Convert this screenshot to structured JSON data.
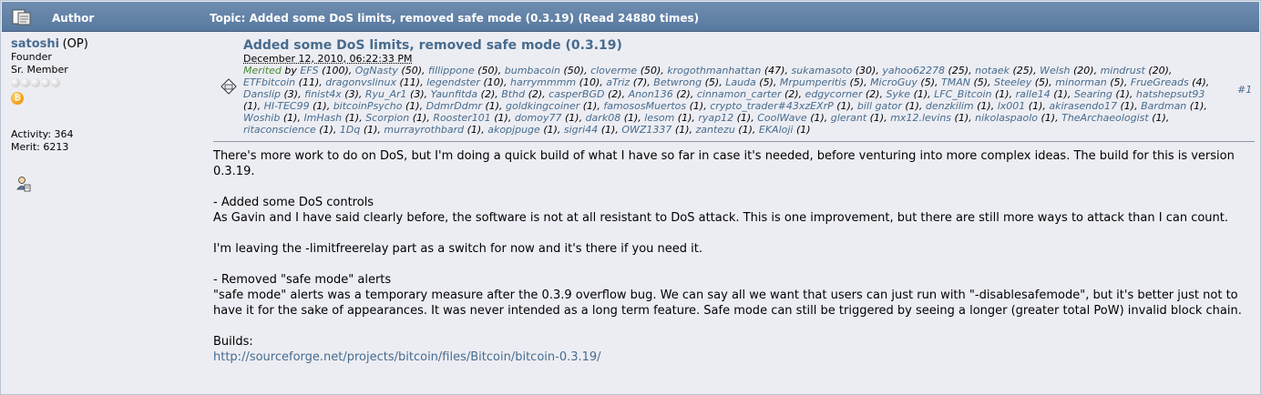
{
  "header": {
    "author_label": "Author",
    "topic_label": "Topic: Added some DoS limits, removed safe mode (0.3.19)  (Read 24880 times)"
  },
  "poster": {
    "name": "satoshi",
    "op_tag": "(OP)",
    "title": "Founder",
    "rank": "Sr. Member",
    "stars": 5,
    "activity": "Activity: 364",
    "merit": "Merit: 6213"
  },
  "post": {
    "subject": "Added some DoS limits, removed safe mode (0.3.19)",
    "date": "December 12, 2010, 06:22:33 PM",
    "merited_label": "Merited",
    "merited_by": "by",
    "merits": [
      [
        "EFS",
        "(100)"
      ],
      [
        "OgNasty",
        "(50)"
      ],
      [
        "fillippone",
        "(50)"
      ],
      [
        "bumbacoin",
        "(50)"
      ],
      [
        "cloverme",
        "(50)"
      ],
      [
        "krogothmanhattan",
        "(47)"
      ],
      [
        "sukamasoto",
        "(30)"
      ],
      [
        "yahoo62278",
        "(25)"
      ],
      [
        "notaek",
        "(25)"
      ],
      [
        "Welsh",
        "(20)"
      ],
      [
        "mindrust",
        "(20)"
      ],
      [
        "ETFbitcoin",
        "(11)"
      ],
      [
        "dragonvslinux",
        "(11)"
      ],
      [
        "legendster",
        "(10)"
      ],
      [
        "harrymmmm",
        "(10)"
      ],
      [
        "aTriz",
        "(7)"
      ],
      [
        "Betwrong",
        "(5)"
      ],
      [
        "Lauda",
        "(5)"
      ],
      [
        "Mrpumperitis",
        "(5)"
      ],
      [
        "MicroGuy",
        "(5)"
      ],
      [
        "TMAN",
        "(5)"
      ],
      [
        "Steeley",
        "(5)"
      ],
      [
        "minorman",
        "(5)"
      ],
      [
        "FrueGreads",
        "(4)"
      ],
      [
        "Danslip",
        "(3)"
      ],
      [
        "finist4x",
        "(3)"
      ],
      [
        "Ryu_Ar1",
        "(3)"
      ],
      [
        "Yaunfitda",
        "(2)"
      ],
      [
        "Bthd",
        "(2)"
      ],
      [
        "casperBGD",
        "(2)"
      ],
      [
        "Anon136",
        "(2)"
      ],
      [
        "cinnamon_carter",
        "(2)"
      ],
      [
        "edgycorner",
        "(2)"
      ],
      [
        "Syke",
        "(1)"
      ],
      [
        "LFC_Bitcoin",
        "(1)"
      ],
      [
        "ralle14",
        "(1)"
      ],
      [
        "Searing",
        "(1)"
      ],
      [
        "hatshepsut93",
        "(1)"
      ],
      [
        "HI-TEC99",
        "(1)"
      ],
      [
        "bitcoinPsycho",
        "(1)"
      ],
      [
        "DdmrDdmr",
        "(1)"
      ],
      [
        "goldkingcoiner",
        "(1)"
      ],
      [
        "famososMuertos",
        "(1)"
      ],
      [
        "crypto_trader#43xzEXrP",
        "(1)"
      ],
      [
        "bill gator",
        "(1)"
      ],
      [
        "denzkilim",
        "(1)"
      ],
      [
        "lx001",
        "(1)"
      ],
      [
        "akirasendo17",
        "(1)"
      ],
      [
        "Bardman",
        "(1)"
      ],
      [
        "Woshib",
        "(1)"
      ],
      [
        "ImHash",
        "(1)"
      ],
      [
        "Scorpion",
        "(1)"
      ],
      [
        "Rooster101",
        "(1)"
      ],
      [
        "domoy77",
        "(1)"
      ],
      [
        "dark08",
        "(1)"
      ],
      [
        "lesom",
        "(1)"
      ],
      [
        "ryap12",
        "(1)"
      ],
      [
        "CoolWave",
        "(1)"
      ],
      [
        "glerant",
        "(1)"
      ],
      [
        "mx12.levins",
        "(1)"
      ],
      [
        "nikolaspaolo",
        "(1)"
      ],
      [
        "TheArchaeologist",
        "(1)"
      ],
      [
        "ritaconscience",
        "(1)"
      ],
      [
        "1Dq",
        "(1)"
      ],
      [
        "murrayrothbard",
        "(1)"
      ],
      [
        "akopjpuge",
        "(1)"
      ],
      [
        "sigri44",
        "(1)"
      ],
      [
        "OWZ1337",
        "(1)"
      ],
      [
        "zantezu",
        "(1)"
      ],
      [
        "EKAloji",
        "(1)"
      ]
    ],
    "post_number": "#1",
    "paragraphs": [
      "There's more work to do on DoS, but I'm doing a quick build of what I have so far in case it's needed, before venturing into more complex ideas.  The build for this is version 0.3.19.",
      "- Added some DoS controls\nAs Gavin and I have said clearly before, the software is not at all resistant to DoS attack.  This is one improvement, but there are still more ways to attack than I can count.",
      "I'm leaving the -limitfreerelay part as a switch for now and it's there if you need it.",
      "- Removed \"safe mode\" alerts\n\"safe mode\" alerts was a temporary measure after the 0.3.9 overflow bug.  We can say all we want that users can just run with \"-disablesafemode\", but it's better just not to have it for the sake of appearances.  It was never intended as a long term feature.  Safe mode can still be triggered by seeing a longer (greater total PoW) invalid block chain."
    ],
    "builds_label": "Builds:",
    "builds_link": "http://sourceforge.net/projects/bitcoin/files/Bitcoin/bitcoin-0.3.19/"
  },
  "colors": {
    "header_bg": "#5f7fa5",
    "link": "#476c8e",
    "merited": "#4a8a2f",
    "background": "#ecedf3"
  },
  "icons": {
    "header_page_icon": "topic-page-icon",
    "message_icon": "message-icon",
    "profile_icon": "profile-icon",
    "coin_icon": "bitcoin-coin-icon"
  }
}
